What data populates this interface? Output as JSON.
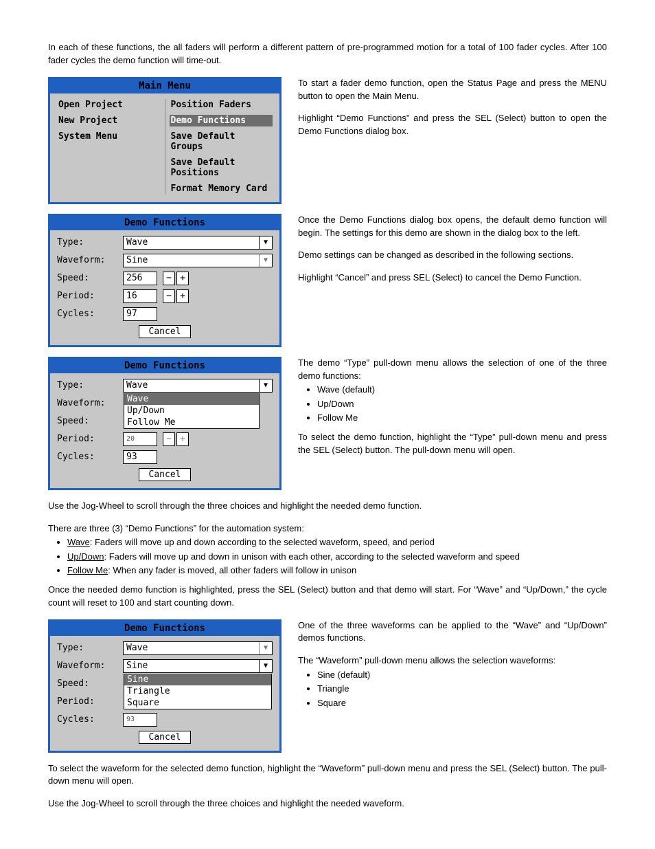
{
  "intro": "In each of these functions, the all faders will perform a different pattern of pre-programmed motion for a total of 100 fader cycles. After 100 fader cycles the demo function will time-out.",
  "mainMenu": {
    "title": "Main Menu",
    "left": [
      "Open Project",
      "New Project",
      "System Menu"
    ],
    "right": [
      "Position Faders",
      "Demo Functions",
      "Save Default Groups",
      "Save Default Positions",
      "Format Memory Card"
    ],
    "selectedRight": 1
  },
  "mainSide": {
    "p1": "To start a fader demo function, open the Status Page and press the MENU button to open the Main Menu.",
    "p2": "Highlight “Demo Functions” and press the SEL (Select) button to open the Demo Functions dialog box."
  },
  "demoLabels": {
    "type": "Type:",
    "waveform": "Waveform:",
    "speed": "Speed:",
    "period": "Period:",
    "cycles": "Cycles:",
    "cancel": "Cancel"
  },
  "demo1": {
    "title": "Demo Functions",
    "type": "Wave",
    "waveform": "Sine",
    "speed": "256",
    "period": "16",
    "cycles": "97"
  },
  "demo1Side": {
    "p1": "Once the Demo Functions dialog box opens, the default demo function will begin. The settings for this demo are shown in the dialog box to the left.",
    "p2": "Demo settings can be changed as described in the following sections.",
    "p3": "Highlight “Cancel” and press SEL (Select) to cancel the Demo Function."
  },
  "demo2": {
    "title": "Demo Functions",
    "type": "Wave",
    "typeOptions": [
      "Wave",
      "Up/Down",
      "Follow Me"
    ],
    "speedPartial": "20",
    "cycles": "93"
  },
  "demo2Side": {
    "p1": "The demo “Type” pull-down menu allows the selection of one of the three demo functions:",
    "bullets": [
      "Wave (default)",
      "Up/Down",
      "Follow Me"
    ],
    "p2": "To select the demo function, highlight the “Type” pull-down menu and press the SEL (Select) button. The pull-down menu will open."
  },
  "midText": {
    "p1": "Use the Jog-Wheel to scroll through the three choices and highlight the needed demo function.",
    "p2": "There are three (3) “Demo Functions” for the automation system:",
    "b1a": "Wave",
    "b1b": ": Faders will move up and down according to the selected waveform, speed, and period",
    "b2a": "Up/Down",
    "b2b": ": Faders will move up and down in unison with each other, according to the selected waveform and speed",
    "b3a": "Follow Me",
    "b3b": ": When any fader is moved, all other faders will follow in unison",
    "p3": "Once the needed demo function is highlighted, press the SEL (Select) button and that demo will start. For “Wave” and “Up/Down,” the cycle count will reset to 100 and start counting down."
  },
  "demo3": {
    "title": "Demo Functions",
    "type": "Wave",
    "waveform": "Sine",
    "waveformOptions": [
      "Sine",
      "Triangle",
      "Square"
    ],
    "cyclesPartial": "93"
  },
  "demo3Side": {
    "p1": "One of the three waveforms can be applied to the “Wave” and “Up/Down” demos functions.",
    "p2": "The “Waveform” pull-down menu allows the selection waveforms:",
    "bullets": [
      "Sine (default)",
      "Triangle",
      "Square"
    ]
  },
  "endText": {
    "p1": "To select the waveform for the selected demo function, highlight the “Waveform” pull-down menu and press the SEL (Select) button. The pull-down menu will open.",
    "p2": "Use the Jog-Wheel to scroll through the three choices and highlight the needed waveform."
  }
}
